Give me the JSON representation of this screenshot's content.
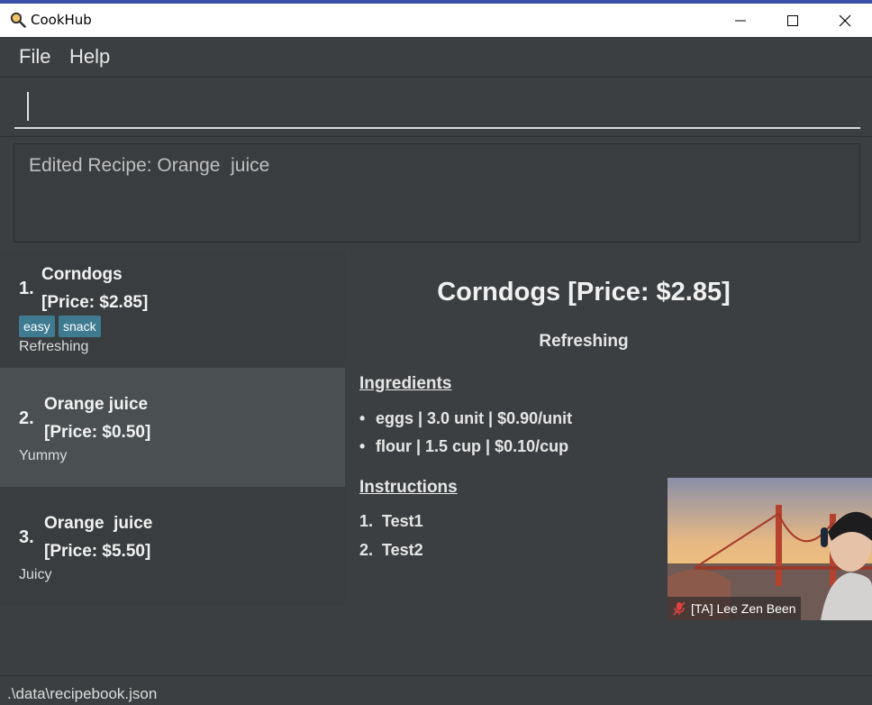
{
  "window": {
    "title": "CookHub"
  },
  "menu": {
    "file": "File",
    "help": "Help"
  },
  "command": {
    "value": ""
  },
  "result": {
    "text": "Edited Recipe: Orange  juice"
  },
  "recipes": [
    {
      "index": "1.",
      "name": "Corndogs",
      "price": "[Price: $2.85]",
      "tags": [
        "easy",
        "snack"
      ],
      "description": "Refreshing"
    },
    {
      "index": "2.",
      "name": "Orange juice",
      "price": "[Price: $0.50]",
      "tags": [],
      "description": "Yummy"
    },
    {
      "index": "3.",
      "name": "Orange  juice",
      "price": "[Price: $5.50]",
      "tags": [],
      "description": "Juicy"
    }
  ],
  "detail": {
    "title": "Corndogs [Price: $2.85]",
    "description": "Refreshing",
    "ingredients_heading": "Ingredients",
    "ingredients": [
      "eggs | 3.0 unit | $0.90/unit",
      "flour | 1.5 cup | $0.10/cup"
    ],
    "instructions_heading": "Instructions",
    "instructions": [
      {
        "num": "1.",
        "text": "Test1"
      },
      {
        "num": "2.",
        "text": "Test2"
      }
    ]
  },
  "status": {
    "path": ".\\data\\recipebook.json"
  },
  "video": {
    "participant": "[TA] Lee Zen Been",
    "muted": true
  },
  "colors": {
    "tag": "#3e7b91",
    "selected_card": "#4a5052",
    "background": "#3c3f41"
  }
}
